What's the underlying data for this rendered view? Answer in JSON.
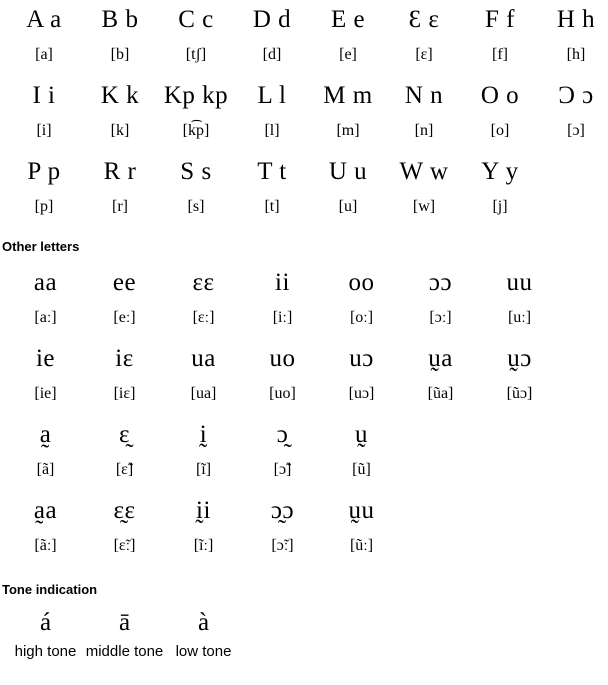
{
  "page": {
    "script_type": "alphabet-chart",
    "background_color": "#ffffff",
    "text_color": "#000000"
  },
  "alphabet": {
    "rows": [
      {
        "letters": [
          {
            "letter": "A a",
            "ipa": "[a]"
          },
          {
            "letter": "B b",
            "ipa": "[b]"
          },
          {
            "letter": "C c",
            "ipa": "[tʃ]"
          },
          {
            "letter": "D d",
            "ipa": "[d]"
          },
          {
            "letter": "E e",
            "ipa": "[e]"
          },
          {
            "letter": "Ɛ ɛ",
            "ipa": "[ɛ]"
          },
          {
            "letter": "F f",
            "ipa": "[f]"
          },
          {
            "letter": "H h",
            "ipa": "[h]"
          }
        ]
      },
      {
        "letters": [
          {
            "letter": "I i",
            "ipa": "[i]"
          },
          {
            "letter": "K k",
            "ipa": "[k]"
          },
          {
            "letter": "Kp kp",
            "ipa": "[k͡p]"
          },
          {
            "letter": "L l",
            "ipa": "[l]"
          },
          {
            "letter": "M m",
            "ipa": "[m]"
          },
          {
            "letter": "N n",
            "ipa": "[n]"
          },
          {
            "letter": "O o",
            "ipa": "[o]"
          },
          {
            "letter": "Ɔ ɔ",
            "ipa": "[ɔ]"
          }
        ]
      },
      {
        "letters": [
          {
            "letter": "P p",
            "ipa": "[p]"
          },
          {
            "letter": "R r",
            "ipa": "[r]"
          },
          {
            "letter": "S s",
            "ipa": "[s]"
          },
          {
            "letter": "T t",
            "ipa": "[t]"
          },
          {
            "letter": "U u",
            "ipa": "[u]"
          },
          {
            "letter": "W w",
            "ipa": "[w]"
          },
          {
            "letter": "Y y",
            "ipa": "[j]"
          },
          {
            "letter": "",
            "ipa": ""
          }
        ]
      }
    ]
  },
  "other_letters": {
    "heading": "Other letters",
    "long_vowels": [
      {
        "letter": "aa",
        "ipa": "[aː]"
      },
      {
        "letter": "ee",
        "ipa": "[eː]"
      },
      {
        "letter": "ɛɛ",
        "ipa": "[ɛː]"
      },
      {
        "letter": "ii",
        "ipa": "[iː]"
      },
      {
        "letter": "oo",
        "ipa": "[oː]"
      },
      {
        "letter": "ɔɔ",
        "ipa": "[ɔː]"
      },
      {
        "letter": "uu",
        "ipa": "[uː]"
      }
    ],
    "diphthongs": [
      {
        "letter": "ie",
        "ipa": "[ie]"
      },
      {
        "letter": "iɛ",
        "ipa": "[iɛ]"
      },
      {
        "letter": "ua",
        "ipa": "[ua]"
      },
      {
        "letter": "uo",
        "ipa": "[uo]"
      },
      {
        "letter": "uɔ",
        "ipa": "[uɔ]"
      },
      {
        "letter": "ṵa",
        "ipa": "[ũa]"
      },
      {
        "letter": "ṵɔ",
        "ipa": "[ũɔ]"
      }
    ],
    "nasal_short": [
      {
        "letter": "a̰",
        "ipa": "[ã]"
      },
      {
        "letter": "ɛ̰",
        "ipa": "[ɛ̃]"
      },
      {
        "letter": "ḭ",
        "ipa": "[ĩ]"
      },
      {
        "letter": "ɔ̰",
        "ipa": "[ɔ̃]"
      },
      {
        "letter": "ṵ",
        "ipa": "[ũ]"
      }
    ],
    "nasal_long": [
      {
        "letter": "a̰a",
        "ipa": "[ãː]"
      },
      {
        "letter": "ɛ̰ɛ",
        "ipa": "[ɛ̃ː]"
      },
      {
        "letter": "ḭi",
        "ipa": "[ĩː]"
      },
      {
        "letter": "ɔ̰ɔ",
        "ipa": "[ɔ̃ː]"
      },
      {
        "letter": "ṵu",
        "ipa": "[ũː]"
      }
    ]
  },
  "tone_indication": {
    "heading": "Tone indication",
    "tones": [
      {
        "mark": "á",
        "label": "high tone"
      },
      {
        "mark": "ā",
        "label": "middle tone"
      },
      {
        "mark": "à",
        "label": "low tone"
      }
    ]
  }
}
